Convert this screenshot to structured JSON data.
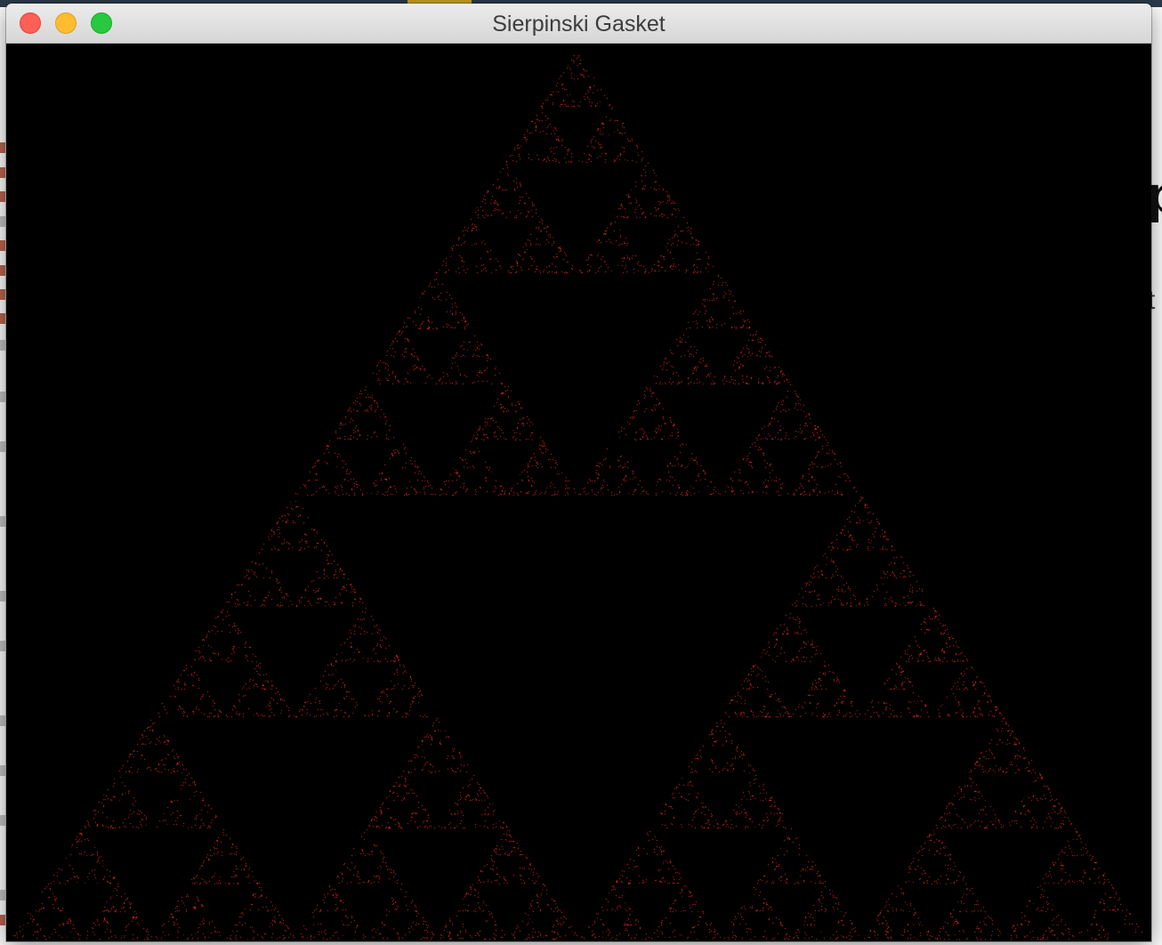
{
  "window": {
    "title": "Sierpinski Gasket",
    "background_color": "#000000"
  },
  "controls": {
    "close_color": "#fe5f57",
    "minimize_color": "#febc2e",
    "zoom_color": "#28c840"
  },
  "fractal": {
    "type": "chaos-game Sierpinski triangle",
    "point_color": "#ff2a2a",
    "depth_visible": 6
  }
}
